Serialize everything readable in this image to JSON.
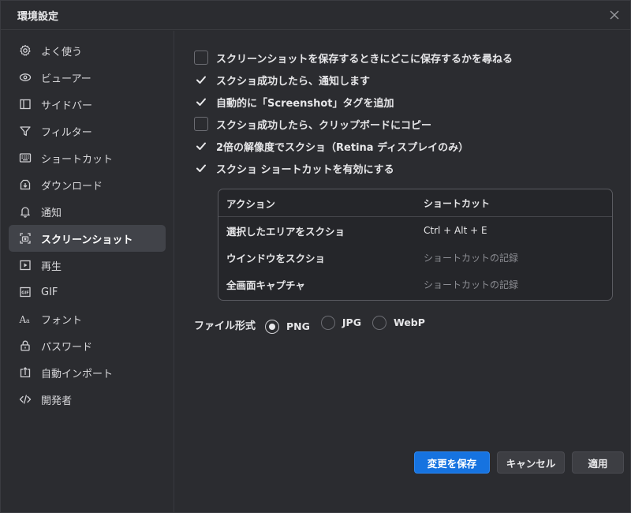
{
  "window": {
    "title": "環境設定"
  },
  "sidebar": {
    "items": [
      {
        "label": "よく使う",
        "icon": "gear-icon",
        "active": false
      },
      {
        "label": "ビューアー",
        "icon": "eye-icon",
        "active": false
      },
      {
        "label": "サイドバー",
        "icon": "sidebar-icon",
        "active": false
      },
      {
        "label": "フィルター",
        "icon": "filter-icon",
        "active": false
      },
      {
        "label": "ショートカット",
        "icon": "keyboard-icon",
        "active": false
      },
      {
        "label": "ダウンロード",
        "icon": "download-icon",
        "active": false
      },
      {
        "label": "通知",
        "icon": "bell-icon",
        "active": false
      },
      {
        "label": "スクリーンショット",
        "icon": "screenshot-icon",
        "active": true
      },
      {
        "label": "再生",
        "icon": "play-icon",
        "active": false
      },
      {
        "label": "GIF",
        "icon": "gif-icon",
        "active": false
      },
      {
        "label": "フォント",
        "icon": "font-icon",
        "active": false
      },
      {
        "label": "パスワード",
        "icon": "lock-icon",
        "active": false
      },
      {
        "label": "自動インポート",
        "icon": "import-icon",
        "active": false
      },
      {
        "label": "開発者",
        "icon": "code-icon",
        "active": false
      }
    ]
  },
  "options": [
    {
      "label": "スクリーンショットを保存するときにどこに保存するかを尋ねる",
      "checked": false
    },
    {
      "label": "スクショ成功したら、通知します",
      "checked": true
    },
    {
      "label": "自動的に「Screenshot」タグを追加",
      "checked": true
    },
    {
      "label": "スクショ成功したら、クリップボードにコピー",
      "checked": false
    },
    {
      "label": "2倍の解像度でスクショ（Retina ディスプレイのみ）",
      "checked": true
    },
    {
      "label": "スクショ ショートカットを有効にする",
      "checked": true
    }
  ],
  "shortcuts": {
    "headers": {
      "action": "アクション",
      "shortcut": "ショートカット"
    },
    "rows": [
      {
        "action": "選択したエリアをスクショ",
        "shortcut": "Ctrl + Alt + E",
        "recorded": true
      },
      {
        "action": "ウインドウをスクショ",
        "shortcut": "ショートカットの記録",
        "recorded": false
      },
      {
        "action": "全画面キャプチャ",
        "shortcut": "ショートカットの記録",
        "recorded": false
      }
    ]
  },
  "file_format": {
    "label": "ファイル形式",
    "options": [
      "PNG",
      "JPG",
      "WebP"
    ],
    "selected": "PNG"
  },
  "buttons": {
    "save": "変更を保存",
    "cancel": "キャンセル",
    "apply": "適用"
  },
  "colors": {
    "accent": "#1673e0",
    "background": "#2b2c30",
    "active_item": "#414349"
  }
}
